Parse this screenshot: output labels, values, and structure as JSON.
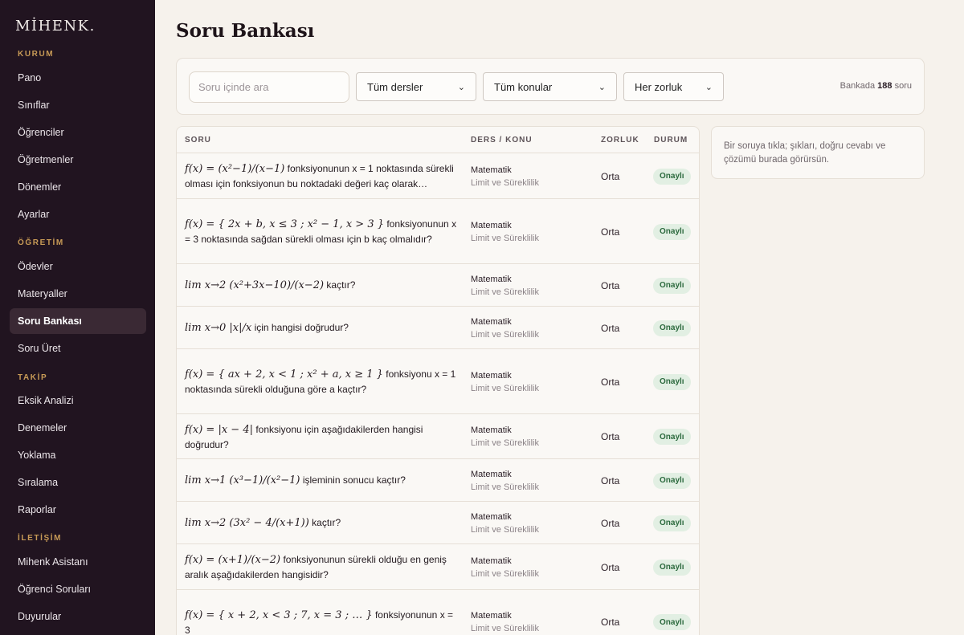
{
  "brand": {
    "logo": "MİHENK."
  },
  "sidebar": {
    "sections": [
      {
        "title": "KURUM",
        "items": [
          "Pano",
          "Sınıflar",
          "Öğrenciler",
          "Öğretmenler",
          "Dönemler",
          "Ayarlar"
        ]
      },
      {
        "title": "ÖĞRETİM",
        "items": [
          "Ödevler",
          "Materyaller",
          "Soru Bankası",
          "Soru Üret"
        ]
      },
      {
        "title": "TAKİP",
        "items": [
          "Eksik Analizi",
          "Denemeler",
          "Yoklama",
          "Sıralama",
          "Raporlar"
        ]
      },
      {
        "title": "İLETİŞİM",
        "items": [
          "Mihenk Asistanı",
          "Öğrenci Soruları",
          "Duyurular"
        ]
      }
    ],
    "active_item": "Soru Bankası"
  },
  "page": {
    "title": "Soru Bankası"
  },
  "filters": {
    "search_placeholder": "Soru içinde ara",
    "subject_select": "Tüm dersler",
    "topic_select": "Tüm konular",
    "difficulty_select": "Her zorluk",
    "count_prefix": "Bankada",
    "count_value": "188",
    "count_suffix": "soru"
  },
  "table": {
    "headers": {
      "question": "SORU",
      "subject": "DERS / KONU",
      "difficulty": "ZORLUK",
      "status": "DURUM"
    },
    "rows": [
      {
        "math": "f(x) = (x²−1)/(x−1)",
        "text": "fonksiyonunun x = 1 noktasında sürekli olması için fonksiyonun bu noktadaki değeri kaç olarak…",
        "subject": "Matematik",
        "topic": "Limit ve Süreklilik",
        "difficulty": "Orta",
        "status": "Onaylı"
      },
      {
        "math": "f(x) = { 2x + b, x ≤ 3 ; x² − 1, x > 3 }",
        "text": "fonksiyonunun x = 3 noktasında sağdan sürekli olması için b kaç olmalıdır?",
        "subject": "Matematik",
        "topic": "Limit ve Süreklilik",
        "difficulty": "Orta",
        "status": "Onaylı"
      },
      {
        "math": "lim x→2 (x²+3x−10)/(x−2)",
        "text": "kaçtır?",
        "subject": "Matematik",
        "topic": "Limit ve Süreklilik",
        "difficulty": "Orta",
        "status": "Onaylı"
      },
      {
        "math": "lim x→0 |x|/x",
        "text": "için hangisi doğrudur?",
        "subject": "Matematik",
        "topic": "Limit ve Süreklilik",
        "difficulty": "Orta",
        "status": "Onaylı"
      },
      {
        "math": "f(x) = { ax + 2, x < 1 ; x² + a, x ≥ 1 }",
        "text": "fonksiyonu x = 1 noktasında sürekli olduğuna göre a kaçtır?",
        "subject": "Matematik",
        "topic": "Limit ve Süreklilik",
        "difficulty": "Orta",
        "status": "Onaylı"
      },
      {
        "math": "f(x) = |x − 4|",
        "text": "fonksiyonu için aşağıdakilerden hangisi doğrudur?",
        "subject": "Matematik",
        "topic": "Limit ve Süreklilik",
        "difficulty": "Orta",
        "status": "Onaylı"
      },
      {
        "math": "lim x→1 (x³−1)/(x²−1)",
        "text": "işleminin sonucu kaçtır?",
        "subject": "Matematik",
        "topic": "Limit ve Süreklilik",
        "difficulty": "Orta",
        "status": "Onaylı"
      },
      {
        "math": "lim x→2 (3x² − 4/(x+1))",
        "text": "kaçtır?",
        "subject": "Matematik",
        "topic": "Limit ve Süreklilik",
        "difficulty": "Orta",
        "status": "Onaylı"
      },
      {
        "math": "f(x) = (x+1)/(x−2)",
        "text": "fonksiyonunun sürekli olduğu en geniş aralık aşağıdakilerden hangisidir?",
        "subject": "Matematik",
        "topic": "Limit ve Süreklilik",
        "difficulty": "Orta",
        "status": "Onaylı"
      },
      {
        "math": "f(x) = { x + 2, x < 3 ; 7, x = 3 ; … }",
        "text": "fonksiyonunun x = 3",
        "subject": "Matematik",
        "topic": "Limit ve Süreklilik",
        "difficulty": "Orta",
        "status": "Onaylı"
      }
    ]
  },
  "detail_panel": {
    "hint": "Bir soruya tıkla; şıkları, doğru cevabı ve çözümü burada görürsün."
  }
}
